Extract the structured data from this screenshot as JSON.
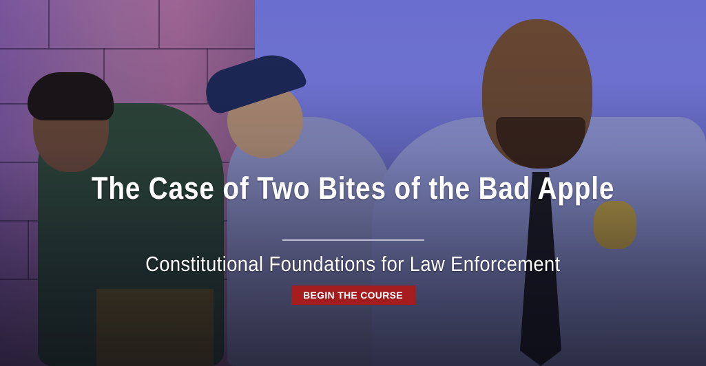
{
  "hero": {
    "title": "The Case of Two Bites of the Bad Apple",
    "subtitle": "Constitutional Foundations for Law Enforcement",
    "cta_label": "BEGIN THE COURSE"
  },
  "colors": {
    "cta_background": "#a51c1f",
    "text": "#ffffff",
    "background_tint": "#7b7fe6"
  }
}
